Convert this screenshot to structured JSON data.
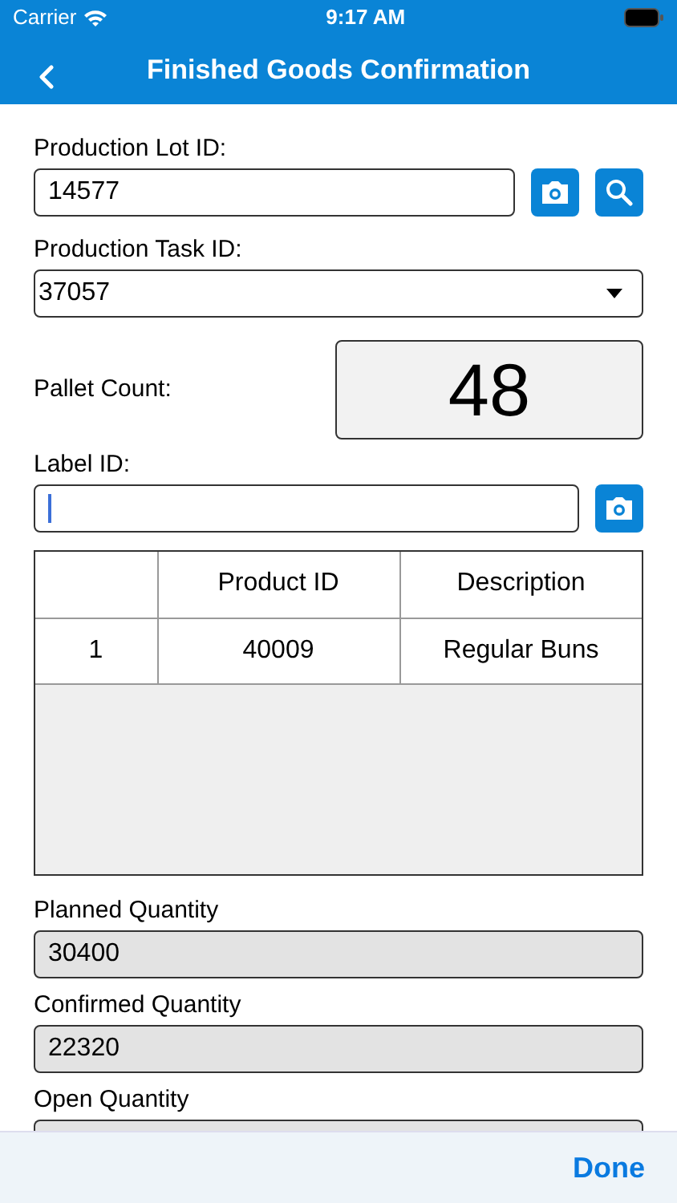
{
  "status_bar": {
    "carrier": "Carrier",
    "time": "9:17 AM"
  },
  "nav": {
    "title": "Finished Goods Confirmation"
  },
  "lot": {
    "label": "Production Lot ID:",
    "value": "14577"
  },
  "task": {
    "label": "Production Task ID:",
    "value": "37057"
  },
  "pallet": {
    "label": "Pallet Count:",
    "value": "48"
  },
  "label_id": {
    "label": "Label ID:",
    "focused": true
  },
  "table": {
    "columns": [
      "",
      "Product ID",
      "Description"
    ],
    "rows": [
      [
        "1",
        "40009",
        "Regular Buns"
      ]
    ]
  },
  "quantities": [
    {
      "label": "Planned Quantity",
      "value": "30400"
    },
    {
      "label": "Confirmed Quantity",
      "value": "22320"
    },
    {
      "label": "Open Quantity"
    }
  ],
  "accessory": {
    "done": "Done"
  }
}
